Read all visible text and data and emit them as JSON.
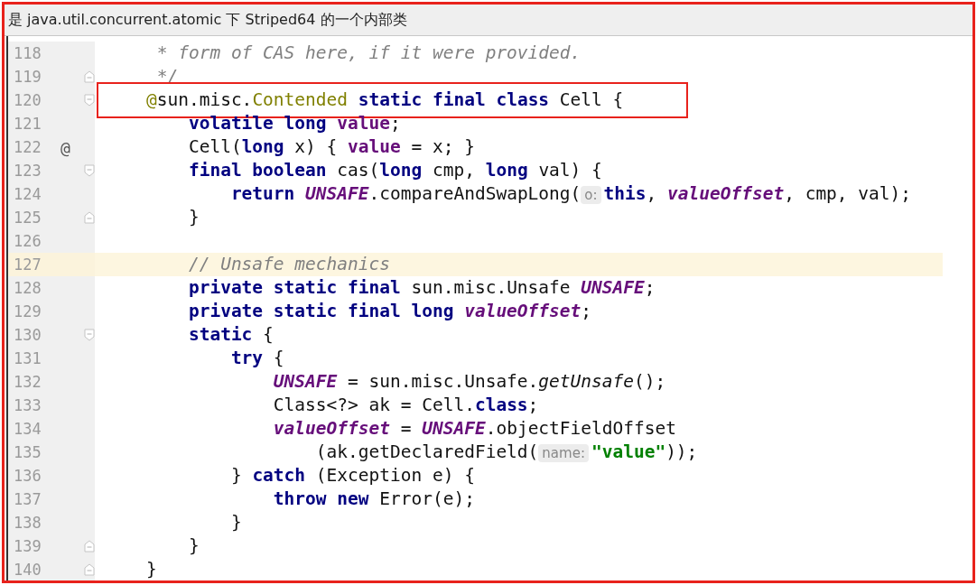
{
  "caption": "是 java.util.concurrent.atomic 下 Striped64 的一个内部类",
  "lines": [
    {
      "number": "118",
      "fold_start": false,
      "fold_end": false,
      "current": false,
      "boxed": false,
      "tokens": [
        {
          "kind": "comment",
          "text": "     * form of CAS here, if it were provided."
        }
      ]
    },
    {
      "number": "119",
      "fold_start": false,
      "fold_end": true,
      "current": false,
      "boxed": false,
      "tokens": [
        {
          "kind": "comment",
          "text": "     */"
        }
      ]
    },
    {
      "number": "120",
      "fold_start": true,
      "fold_end": false,
      "current": false,
      "boxed": true,
      "tokens": [
        {
          "kind": "annotation",
          "text": "    @"
        },
        {
          "kind": "plain",
          "text": "sun.misc."
        },
        {
          "kind": "annotation",
          "text": "Contended"
        },
        {
          "kind": "keyword",
          "text": " static final class"
        },
        {
          "kind": "plain",
          "text": " Cell {"
        }
      ]
    },
    {
      "number": "121",
      "fold_start": false,
      "fold_end": false,
      "current": false,
      "boxed": false,
      "tokens": [
        {
          "kind": "keyword",
          "text": "        volatile long"
        },
        {
          "kind": "field",
          "text": " value"
        },
        {
          "kind": "plain",
          "text": ";"
        }
      ]
    },
    {
      "number": "122",
      "fold_start": false,
      "fold_end": false,
      "mark": "@",
      "current": false,
      "boxed": false,
      "tokens": [
        {
          "kind": "plain",
          "text": "        Cell("
        },
        {
          "kind": "keyword",
          "text": "long"
        },
        {
          "kind": "plain",
          "text": " x) { "
        },
        {
          "kind": "field",
          "text": "value"
        },
        {
          "kind": "plain",
          "text": " = x; }"
        }
      ]
    },
    {
      "number": "123",
      "fold_start": true,
      "fold_end": false,
      "current": false,
      "boxed": false,
      "tokens": [
        {
          "kind": "keyword",
          "text": "        final boolean"
        },
        {
          "kind": "plain",
          "text": " cas("
        },
        {
          "kind": "keyword",
          "text": "long"
        },
        {
          "kind": "plain",
          "text": " cmp, "
        },
        {
          "kind": "keyword",
          "text": "long"
        },
        {
          "kind": "plain",
          "text": " val) {"
        }
      ]
    },
    {
      "number": "124",
      "fold_start": false,
      "fold_end": false,
      "current": false,
      "boxed": false,
      "tokens": [
        {
          "kind": "keyword",
          "text": "            return"
        },
        {
          "kind": "static",
          "text": " UNSAFE"
        },
        {
          "kind": "plain",
          "text": ".compareAndSwapLong("
        },
        {
          "kind": "hint",
          "text": "o:"
        },
        {
          "kind": "keyword",
          "text": "this"
        },
        {
          "kind": "plain",
          "text": ", "
        },
        {
          "kind": "static",
          "text": "valueOffset"
        },
        {
          "kind": "plain",
          "text": ", cmp, val);"
        }
      ]
    },
    {
      "number": "125",
      "fold_start": false,
      "fold_end": true,
      "current": false,
      "boxed": false,
      "tokens": [
        {
          "kind": "plain",
          "text": "        }"
        }
      ]
    },
    {
      "number": "126",
      "fold_start": false,
      "fold_end": false,
      "current": false,
      "boxed": false
    },
    {
      "number": "127",
      "fold_start": false,
      "fold_end": false,
      "current": true,
      "boxed": false,
      "tokens": [
        {
          "kind": "comment",
          "text": "        // Unsafe mechanics"
        }
      ]
    },
    {
      "number": "128",
      "fold_start": false,
      "fold_end": false,
      "current": false,
      "boxed": false,
      "tokens": [
        {
          "kind": "keyword",
          "text": "        private static final"
        },
        {
          "kind": "plain",
          "text": " sun.misc.Unsafe "
        },
        {
          "kind": "static",
          "text": "UNSAFE"
        },
        {
          "kind": "plain",
          "text": ";"
        }
      ]
    },
    {
      "number": "129",
      "fold_start": false,
      "fold_end": false,
      "current": false,
      "boxed": false,
      "tokens": [
        {
          "kind": "keyword",
          "text": "        private static final long"
        },
        {
          "kind": "static",
          "text": " valueOffset"
        },
        {
          "kind": "plain",
          "text": ";"
        }
      ]
    },
    {
      "number": "130",
      "fold_start": true,
      "fold_end": false,
      "current": false,
      "boxed": false,
      "tokens": [
        {
          "kind": "keyword",
          "text": "        static"
        },
        {
          "kind": "plain",
          "text": " {"
        }
      ]
    },
    {
      "number": "131",
      "fold_start": false,
      "fold_end": false,
      "current": false,
      "boxed": false,
      "tokens": [
        {
          "kind": "keyword",
          "text": "            try"
        },
        {
          "kind": "plain",
          "text": " {"
        }
      ]
    },
    {
      "number": "132",
      "fold_start": false,
      "fold_end": false,
      "current": false,
      "boxed": false,
      "tokens": [
        {
          "kind": "static",
          "text": "                UNSAFE"
        },
        {
          "kind": "plain",
          "text": " = sun.misc.Unsafe."
        },
        {
          "kind": "method",
          "text": "getUnsafe"
        },
        {
          "kind": "plain",
          "text": "();"
        }
      ]
    },
    {
      "number": "133",
      "fold_start": false,
      "fold_end": false,
      "current": false,
      "boxed": false,
      "tokens": [
        {
          "kind": "plain",
          "text": "                Class<?> ak = Cell."
        },
        {
          "kind": "keyword",
          "text": "class"
        },
        {
          "kind": "plain",
          "text": ";"
        }
      ]
    },
    {
      "number": "134",
      "fold_start": false,
      "fold_end": false,
      "current": false,
      "boxed": false,
      "tokens": [
        {
          "kind": "static",
          "text": "                valueOffset"
        },
        {
          "kind": "plain",
          "text": " = "
        },
        {
          "kind": "static",
          "text": "UNSAFE"
        },
        {
          "kind": "plain",
          "text": ".objectFieldOffset"
        }
      ]
    },
    {
      "number": "135",
      "fold_start": false,
      "fold_end": false,
      "current": false,
      "boxed": false,
      "tokens": [
        {
          "kind": "plain",
          "text": "                    (ak.getDeclaredField("
        },
        {
          "kind": "hint",
          "text": "name:"
        },
        {
          "kind": "string",
          "text": "\"value\""
        },
        {
          "kind": "plain",
          "text": "));"
        }
      ]
    },
    {
      "number": "136",
      "fold_start": false,
      "fold_end": false,
      "current": false,
      "boxed": false,
      "tokens": [
        {
          "kind": "plain",
          "text": "            } "
        },
        {
          "kind": "keyword",
          "text": "catch"
        },
        {
          "kind": "plain",
          "text": " (Exception e) {"
        }
      ]
    },
    {
      "number": "137",
      "fold_start": false,
      "fold_end": false,
      "current": false,
      "boxed": false,
      "tokens": [
        {
          "kind": "keyword",
          "text": "                throw new"
        },
        {
          "kind": "plain",
          "text": " Error(e);"
        }
      ]
    },
    {
      "number": "138",
      "fold_start": false,
      "fold_end": false,
      "current": false,
      "boxed": false,
      "tokens": [
        {
          "kind": "plain",
          "text": "            }"
        }
      ]
    },
    {
      "number": "139",
      "fold_start": false,
      "fold_end": true,
      "current": false,
      "boxed": false,
      "tokens": [
        {
          "kind": "plain",
          "text": "        }"
        }
      ]
    },
    {
      "number": "140",
      "fold_start": false,
      "fold_end": true,
      "current": false,
      "boxed": false,
      "tokens": [
        {
          "kind": "plain",
          "text": "    }"
        }
      ]
    }
  ]
}
